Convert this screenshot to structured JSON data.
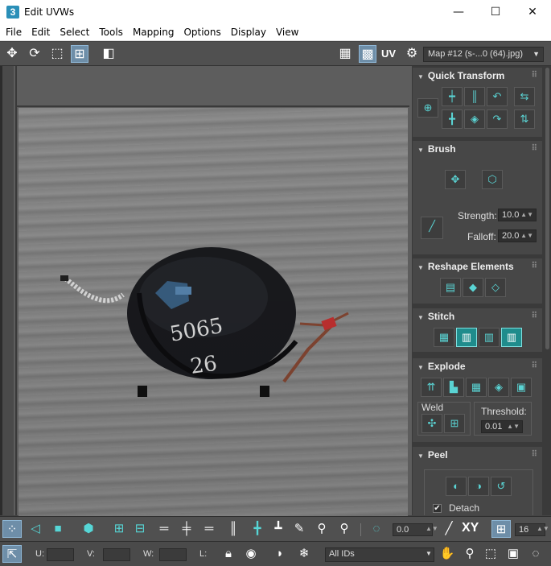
{
  "window": {
    "app_icon": "3",
    "title": "Edit UVWs",
    "minimize": "—",
    "maximize": "☐",
    "close": "✕"
  },
  "menu": [
    "File",
    "Edit",
    "Select",
    "Tools",
    "Mapping",
    "Options",
    "Display",
    "View"
  ],
  "toolbar": {
    "uv_label": "UV",
    "map_select": "Map #12 (s-...0 (64).jpg)"
  },
  "panel": {
    "quick_transform": {
      "title": "Quick Transform"
    },
    "brush": {
      "title": "Brush",
      "strength_label": "Strength:",
      "strength_value": "10.0",
      "falloff_label": "Falloff:",
      "falloff_value": "20.0"
    },
    "reshape": {
      "title": "Reshape Elements"
    },
    "stitch": {
      "title": "Stitch"
    },
    "explode": {
      "title": "Explode",
      "weld_label": "Weld",
      "threshold_label": "Threshold:",
      "threshold_value": "0.01"
    },
    "peel": {
      "title": "Peel",
      "detach_label": "Detach",
      "detach_checked": true
    }
  },
  "bottom": {
    "rotation_value": "0.0",
    "xy_label": "XY",
    "pixel_snap_value": "16",
    "u_label": "U:",
    "v_label": "V:",
    "w_label": "W:",
    "l_label": "L:",
    "ids_select": "All IDs"
  },
  "colors": {
    "accent_teal": "#56d6d6",
    "active_blue": "#6e8ea8",
    "panel_bg": "#474747"
  }
}
